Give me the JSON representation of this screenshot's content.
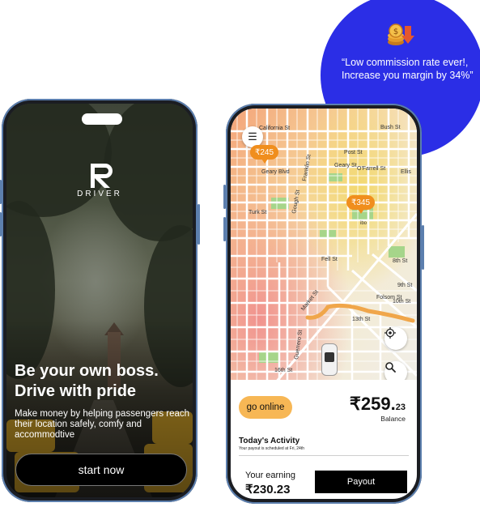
{
  "bubble": {
    "quote": "“Low commission rate ever!, Increase you margin by 34%”",
    "icon": "coin-down-arrow-icon"
  },
  "left_phone": {
    "brand_text": "DRIVER",
    "headline": "Be your own boss. Drive with pride",
    "subcopy": "Make money by helping passengers reach their location safely, comfy and accommodtive",
    "start_button": "start now"
  },
  "right_phone": {
    "map": {
      "price_pins": [
        "₹245",
        "₹345"
      ],
      "streets": [
        "California St",
        "Bush St",
        "Geary Blvd",
        "Post St",
        "Geary St",
        "O'Farrell St",
        "Ellis",
        "Franklin St",
        "Gough St",
        "Turk St",
        "Fell St",
        "8th St",
        "Market St",
        "Folsom St",
        "9th St",
        "10th St",
        "13th St",
        "Guerrero St",
        "16th St"
      ],
      "label_ibo": "ibo"
    },
    "online_button": "go online",
    "balance": {
      "amount": "₹259.",
      "cents": "23",
      "label": "Balance"
    },
    "activity": {
      "title": "Today's Activity",
      "note": "Your payout is scheduled at Fri, 24th"
    },
    "earning": {
      "label": "Your earning",
      "amount": "₹230.23"
    },
    "payout_button": "Payout"
  },
  "colors": {
    "accent_blue": "#2b2ee6",
    "pin_orange": "#f08e1d",
    "online_yellow": "#f7b755",
    "route": "#f0a64a"
  }
}
